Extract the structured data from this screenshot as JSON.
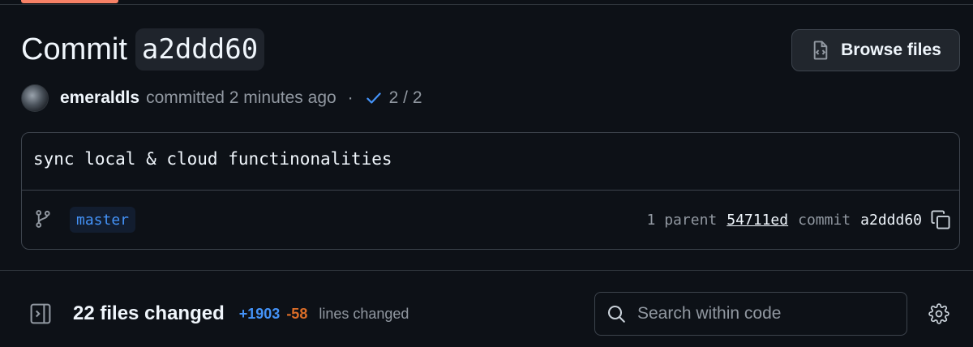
{
  "header": {
    "title_word": "Commit",
    "title_sha": "a2ddd60",
    "browse_label": "Browse files"
  },
  "meta": {
    "author": "emeraldls",
    "committed_text": "committed 2 minutes ago",
    "separator": "·",
    "checks": "2 / 2"
  },
  "commit": {
    "message": "sync local & cloud functinonalities",
    "branch": "master",
    "parent_label": "1 parent",
    "parent_sha": "54711ed",
    "commit_label": "commit",
    "commit_sha": "a2ddd60"
  },
  "files": {
    "changed_label": "22 files changed",
    "additions": "+1903",
    "deletions": "-58",
    "lines_label": "lines changed",
    "search_placeholder": "Search within code"
  },
  "colors": {
    "background": "#0d1117",
    "accent_blue": "#4493f8",
    "deletions_orange": "#db6d28",
    "tab_underline": "#f78166"
  },
  "icons": [
    "file-code-icon",
    "check-icon",
    "git-branch-icon",
    "copy-icon",
    "sidebar-toggle-icon",
    "search-icon",
    "gear-icon"
  ]
}
